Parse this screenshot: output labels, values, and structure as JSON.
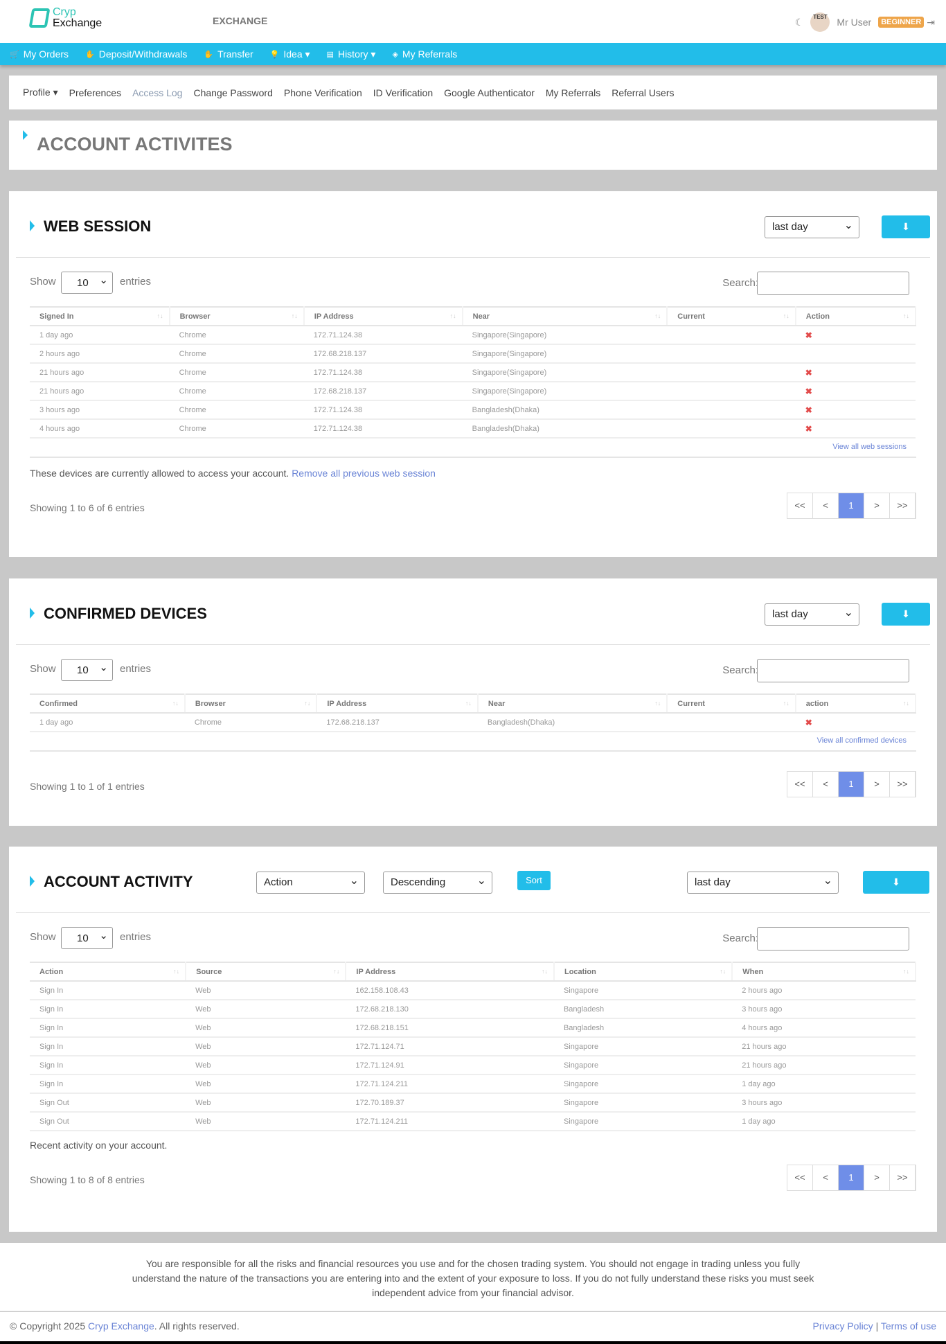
{
  "header": {
    "logo_top": "Cryp",
    "logo_bottom": "Exchange",
    "center_label": "EXCHANGE",
    "user_name": "Mr User",
    "avatar_text": "TEST",
    "level_badge": "BEGINNER"
  },
  "main_nav": [
    {
      "label": "My Orders",
      "icon": "cart-icon",
      "glyph": "🛒"
    },
    {
      "label": "Deposit/Withdrawals",
      "icon": "hand-icon",
      "glyph": "✋"
    },
    {
      "label": "Transfer",
      "icon": "hand-icon",
      "glyph": "✋"
    },
    {
      "label": "Idea ▾",
      "icon": "lightbulb-icon",
      "glyph": "💡"
    },
    {
      "label": "History ▾",
      "icon": "archive-icon",
      "glyph": "▤"
    },
    {
      "label": "My Referrals",
      "icon": "tag-icon",
      "glyph": "◈"
    }
  ],
  "sub_nav": [
    "Profile ▾",
    "Preferences",
    "Access Log",
    "Change Password",
    "Phone Verification",
    "ID Verification",
    "Google Authenticator",
    "My Referrals",
    "Referral Users"
  ],
  "page_title": "ACCOUNT ACTIVITES",
  "common": {
    "show": "Show",
    "entries": "entries",
    "search": "Search:",
    "length": "10",
    "download_glyph": "⬇",
    "pager": [
      "<<",
      "<",
      "1",
      ">",
      ">>"
    ]
  },
  "web_session": {
    "title": "WEB SESSION",
    "range": "last day",
    "columns": [
      "Signed In",
      "Browser",
      "IP Address",
      "Near",
      "Current",
      "Action"
    ],
    "rows": [
      [
        "1 day ago",
        "Chrome",
        "172.71.124.38",
        "Singapore(Singapore)",
        "",
        "✖"
      ],
      [
        "2 hours ago",
        "Chrome",
        "172.68.218.137",
        "Singapore(Singapore)",
        "",
        ""
      ],
      [
        "21 hours ago",
        "Chrome",
        "172.71.124.38",
        "Singapore(Singapore)",
        "",
        "✖"
      ],
      [
        "21 hours ago",
        "Chrome",
        "172.68.218.137",
        "Singapore(Singapore)",
        "",
        "✖"
      ],
      [
        "3 hours ago",
        "Chrome",
        "172.71.124.38",
        "Bangladesh(Dhaka)",
        "",
        "✖"
      ],
      [
        "4 hours ago",
        "Chrome",
        "172.71.124.38",
        "Bangladesh(Dhaka)",
        "",
        "✖"
      ]
    ],
    "view_all": "View all web sessions",
    "note": "These devices are currently allowed to access your account.",
    "note_link": "Remove all previous web session",
    "showing": "Showing 1 to 6 of 6 entries"
  },
  "confirmed_devices": {
    "title": "CONFIRMED DEVICES",
    "range": "last day",
    "columns": [
      "Confirmed",
      "Browser",
      "IP Address",
      "Near",
      "Current",
      "action"
    ],
    "rows": [
      [
        "1 day ago",
        "Chrome",
        "172.68.218.137",
        "Bangladesh(Dhaka)",
        "",
        "✖"
      ]
    ],
    "view_all": "View all confirmed devices",
    "showing": "Showing 1 to 1 of 1 entries"
  },
  "account_activity": {
    "title": "ACCOUNT ACTIVITY",
    "filter": "Action",
    "order": "Descending",
    "sort_label": "Sort",
    "range": "last day",
    "columns": [
      "Action",
      "Source",
      "IP Address",
      "Location",
      "When"
    ],
    "rows": [
      [
        "Sign In",
        "Web",
        "162.158.108.43",
        "Singapore",
        "2 hours ago"
      ],
      [
        "Sign In",
        "Web",
        "172.68.218.130",
        "Bangladesh",
        "3 hours ago"
      ],
      [
        "Sign In",
        "Web",
        "172.68.218.151",
        "Bangladesh",
        "4 hours ago"
      ],
      [
        "Sign In",
        "Web",
        "172.71.124.71",
        "Singapore",
        "21 hours ago"
      ],
      [
        "Sign In",
        "Web",
        "172.71.124.91",
        "Singapore",
        "21 hours ago"
      ],
      [
        "Sign In",
        "Web",
        "172.71.124.211",
        "Singapore",
        "1 day ago"
      ],
      [
        "Sign Out",
        "Web",
        "172.70.189.37",
        "Singapore",
        "3 hours ago"
      ],
      [
        "Sign Out",
        "Web",
        "172.71.124.211",
        "Singapore",
        "1 day ago"
      ]
    ],
    "note": "Recent activity on your account.",
    "showing": "Showing 1 to 8 of 8 entries"
  },
  "footer": {
    "disclaimer": "You are responsible for all the risks and financial resources you use and for the chosen trading system. You should not engage in trading unless you fully understand the nature of the transactions you are entering into and the extent of your exposure to loss. If you do not fully understand these risks you must seek independent advice from your financial advisor.",
    "copyright_prefix": "© Copyright 2025",
    "brand": "Cryp Exchange",
    "copyright_suffix": ". All rights reserved.",
    "privacy": "Privacy Policy",
    "separator": "|",
    "terms": "Terms of use"
  }
}
